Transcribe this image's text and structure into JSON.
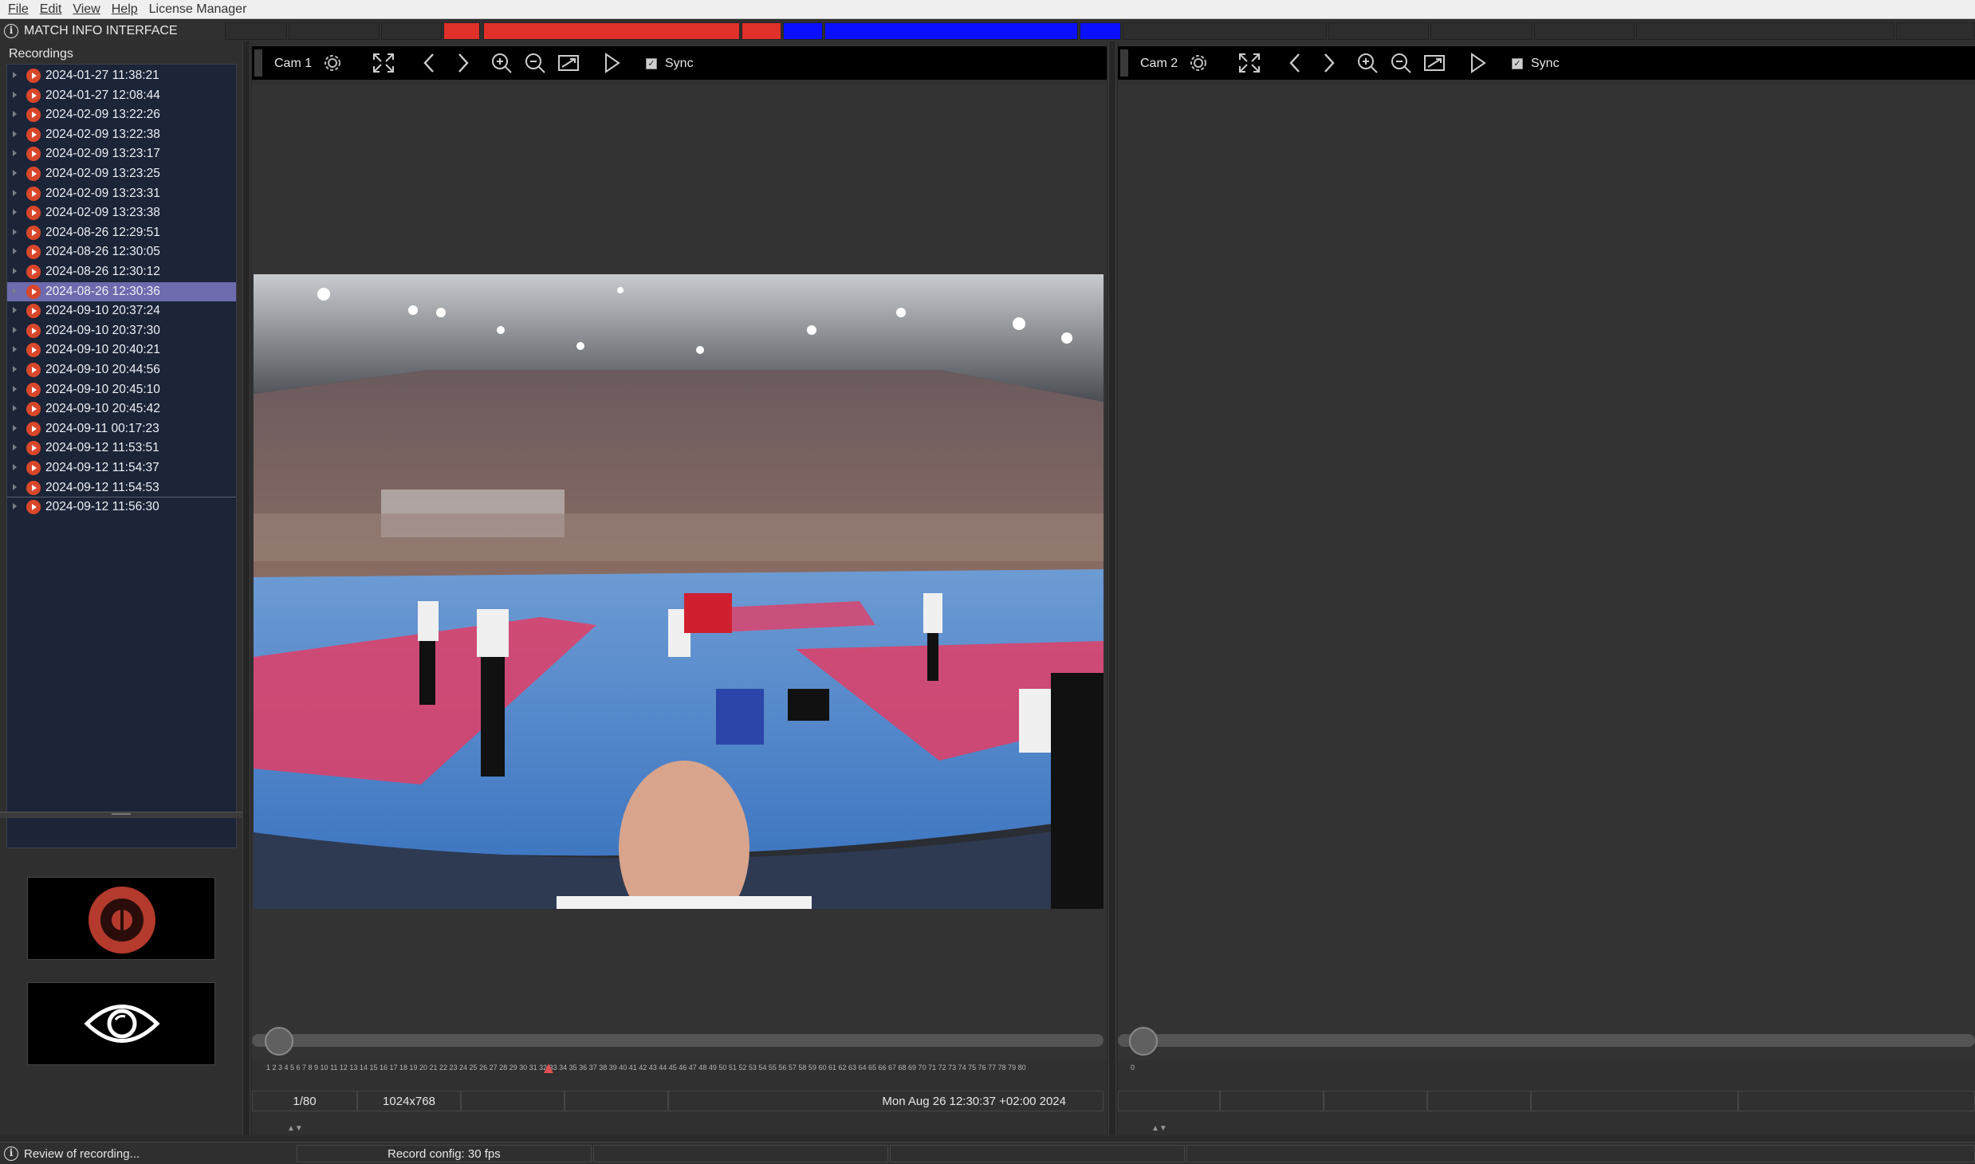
{
  "menu": {
    "file": "File",
    "edit": "Edit",
    "view": "View",
    "help": "Help",
    "license": "License Manager"
  },
  "match_bar": {
    "title": "MATCH INFO INTERFACE",
    "red_color": "#e0302a",
    "blue_color": "#0a10ff"
  },
  "recordings": {
    "header": "Recordings",
    "items": [
      "2024-01-27 11:38:21",
      "2024-01-27 12:08:44",
      "2024-02-09 13:22:26",
      "2024-02-09 13:22:38",
      "2024-02-09 13:23:17",
      "2024-02-09 13:23:25",
      "2024-02-09 13:23:31",
      "2024-02-09 13:23:38",
      "2024-08-26 12:29:51",
      "2024-08-26 12:30:05",
      "2024-08-26 12:30:12",
      "2024-08-26 12:30:36",
      "2024-09-10 20:37:24",
      "2024-09-10 20:37:30",
      "2024-09-10 20:40:21",
      "2024-09-10 20:44:56",
      "2024-09-10 20:45:10",
      "2024-09-10 20:45:42",
      "2024-09-11 00:17:23",
      "2024-09-12 11:53:51",
      "2024-09-12 11:54:37",
      "2024-09-12 11:54:53",
      "2024-09-12 11:56:30"
    ],
    "selected_index": 11
  },
  "cam1": {
    "title": "Cam 1",
    "sync_label": "Sync",
    "sync_checked": true,
    "frame_counter": "1/80",
    "resolution": "1024x768",
    "timestamp": "Mon Aug 26 12:30:37 +02:00 2024",
    "tick_labels": "1 2 3 4 5 6 7 8 9 10 11 12 13 14 15 16 17 18 19 20 21 22 23 24 25 26 27 28 29 30 31 32 33 34 35 36 37 38 39 40 41 42 43 44 45 46 47 48 49 50 51 52 53 54 55 56 57 58 59 60 61 62 63 64 65 66 67 68 69 70 71 72 73 74 75 76 77 78 79 80",
    "position_fraction": 0
  },
  "cam2": {
    "title": "Cam 2",
    "sync_label": "Sync",
    "sync_checked": true,
    "tick_zero": "0",
    "position_fraction": 0
  },
  "statusbar": {
    "message": "Review of recording...",
    "record_config": "Record config: 30 fps"
  },
  "icons": {
    "settings": "gear-icon",
    "fullscreen": "expand-icon",
    "prev": "chevron-left-icon",
    "next": "chevron-right-icon",
    "zoom_in": "zoom-in-icon",
    "zoom_out": "zoom-out-icon",
    "fit": "fit-icon",
    "play": "play-icon",
    "record": "record-icon",
    "view": "eye-icon",
    "info": "info-icon"
  }
}
